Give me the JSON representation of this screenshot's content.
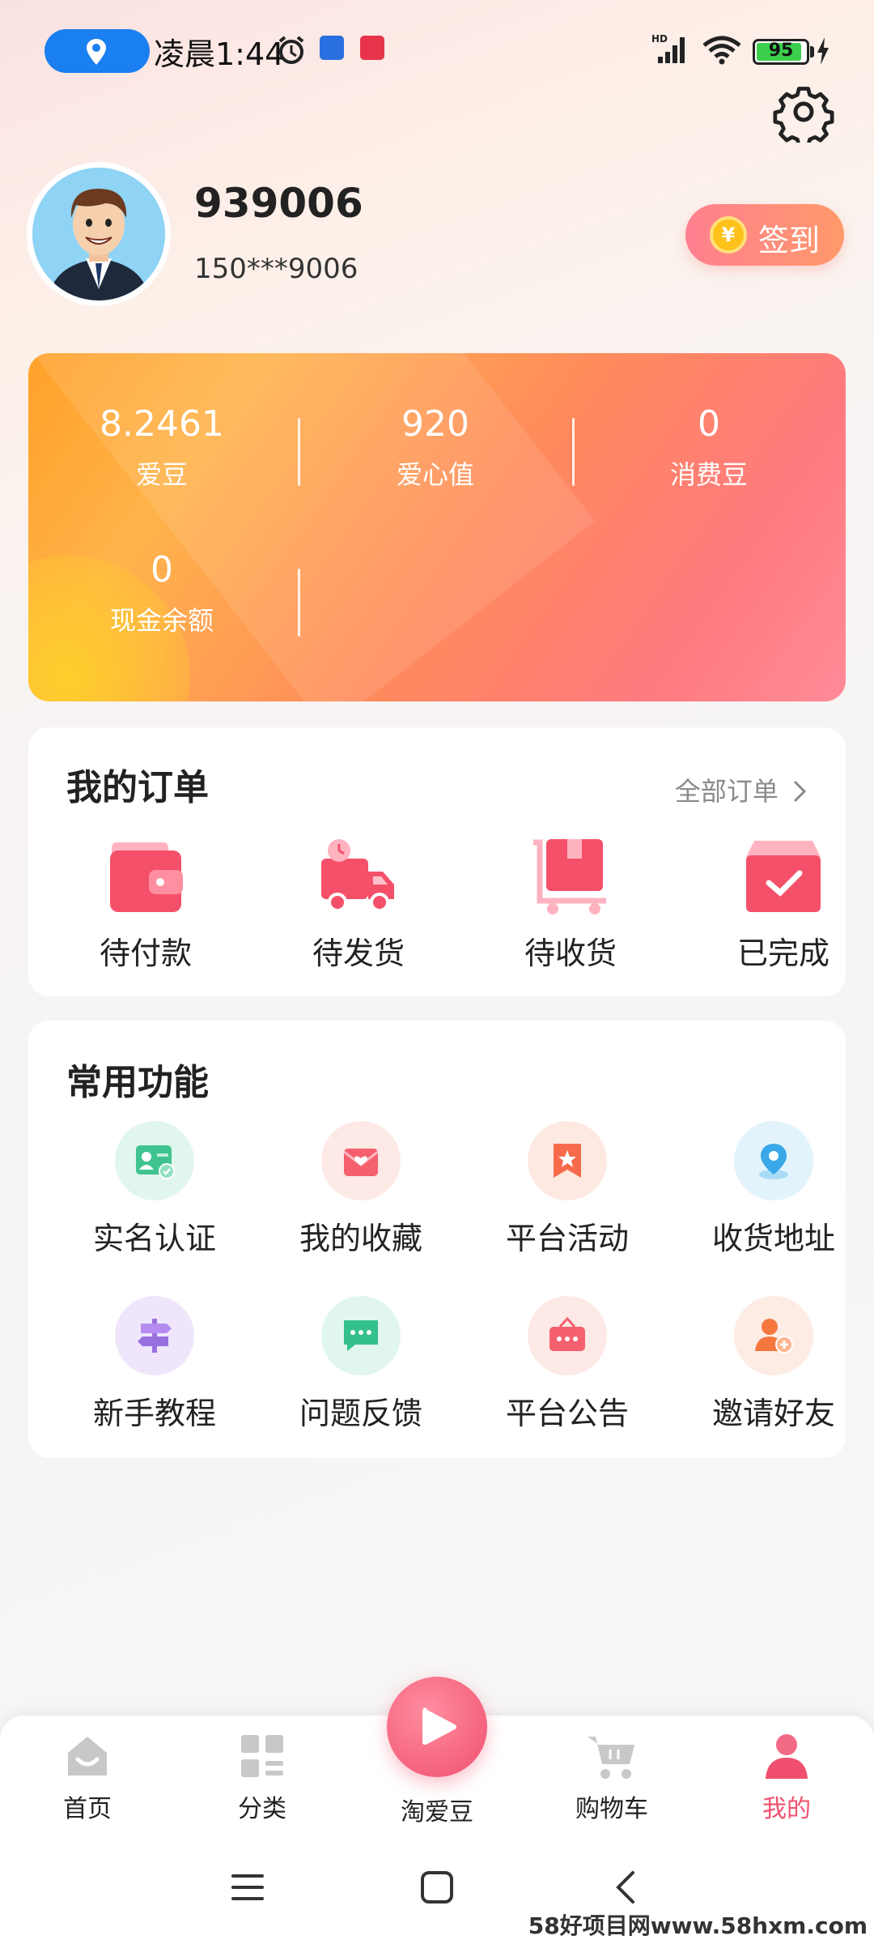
{
  "status_bar": {
    "time": "凌晨1:44",
    "battery": "95"
  },
  "profile": {
    "username": "939006",
    "phone": "150***9006",
    "signin_coin": "¥",
    "signin_label": "签到"
  },
  "stats": [
    {
      "value": "8.2461",
      "label": "爱豆"
    },
    {
      "value": "920",
      "label": "爱心值"
    },
    {
      "value": "0",
      "label": "消费豆"
    },
    {
      "value": "0",
      "label": "现金余额"
    }
  ],
  "orders": {
    "title": "我的订单",
    "all_label": "全部订单",
    "items": [
      {
        "label": "待付款",
        "icon": "wallet-icon"
      },
      {
        "label": "待发货",
        "icon": "delivery-truck-icon"
      },
      {
        "label": "待收货",
        "icon": "package-cart-icon"
      },
      {
        "label": "已完成",
        "icon": "completed-box-icon"
      }
    ]
  },
  "functions": {
    "title": "常用功能",
    "items": [
      {
        "label": "实名认证",
        "icon": "id-card-icon"
      },
      {
        "label": "我的收藏",
        "icon": "favorite-envelope-icon"
      },
      {
        "label": "平台活动",
        "icon": "star-bookmark-icon"
      },
      {
        "label": "收货地址",
        "icon": "location-pin-icon"
      },
      {
        "label": "新手教程",
        "icon": "signpost-icon"
      },
      {
        "label": "问题反馈",
        "icon": "chat-bubble-icon"
      },
      {
        "label": "平台公告",
        "icon": "notice-board-icon"
      },
      {
        "label": "邀请好友",
        "icon": "add-user-icon"
      }
    ]
  },
  "bottom_nav": [
    {
      "label": "首页",
      "icon": "home-icon"
    },
    {
      "label": "分类",
      "icon": "category-grid-icon"
    },
    {
      "label": "淘爱豆",
      "icon": "play-icon"
    },
    {
      "label": "购物车",
      "icon": "shopping-cart-icon"
    },
    {
      "label": "我的",
      "icon": "user-icon",
      "active": true
    }
  ],
  "colors": {
    "accent": "#f0506e",
    "stats_gradient_start": "#ffa12a",
    "stats_gradient_end": "#ff8b98"
  },
  "watermark": "58好项目网www.58hxm.com"
}
